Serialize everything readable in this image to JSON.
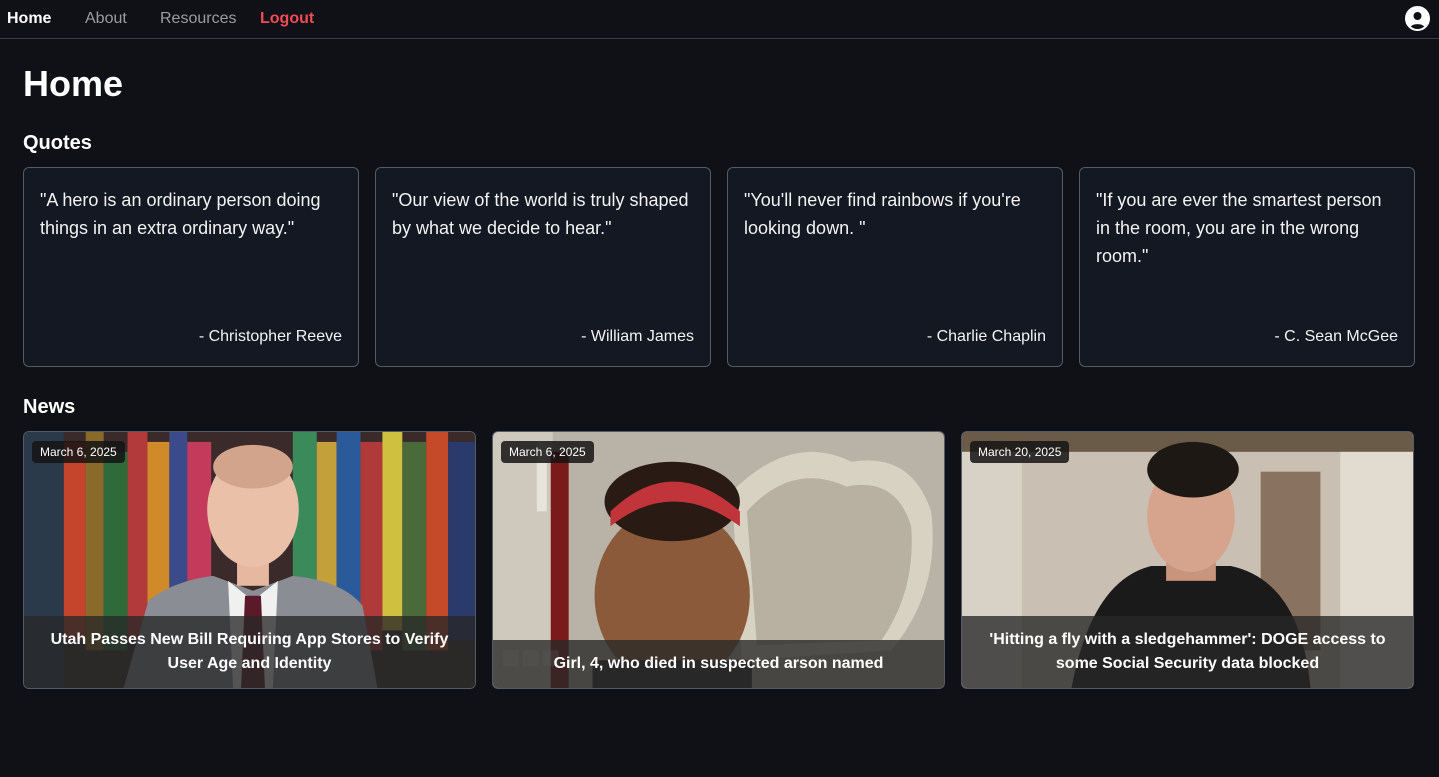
{
  "nav": {
    "items": [
      {
        "label": "Home"
      },
      {
        "label": "About"
      },
      {
        "label": "Resources"
      },
      {
        "label": "Logout"
      }
    ],
    "profile_icon": "user-circle-icon"
  },
  "page": {
    "title": "Home",
    "quotes_heading": "Quotes",
    "news_heading": "News"
  },
  "quotes": [
    {
      "text": "\"A hero is an ordinary person doing things in an extra ordinary way.\"",
      "author": "- Christopher Reeve"
    },
    {
      "text": "\"Our view of the world is truly shaped by what we decide to hear.\"",
      "author": "- William James"
    },
    {
      "text": "\"You'll never find rainbows if you're looking down. \"",
      "author": "- Charlie Chaplin"
    },
    {
      "text": "\"If you are ever the smartest person in the room, you are in the wrong room.\"",
      "author": "- C. Sean McGee"
    }
  ],
  "news": [
    {
      "date": "March 6, 2025",
      "title": "Utah Passes New Bill Requiring App Stores to Verify User Age and Identity"
    },
    {
      "date": "March 6, 2025",
      "title": "Girl, 4, who died in suspected arson named",
      "watermark": "BBC NEWS"
    },
    {
      "date": "March 20, 2025",
      "title": "'Hitting a fly with a sledgehammer': DOGE access to some Social Security data blocked"
    }
  ],
  "colors": {
    "background": "#0f1117",
    "card": "#131822",
    "card_border": "#555a64",
    "logout": "#ef4b57",
    "nav_inactive": "#9a9ca2"
  }
}
